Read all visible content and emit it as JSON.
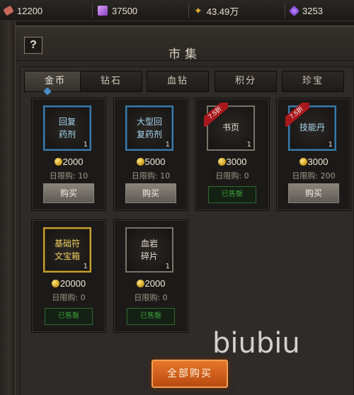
{
  "currencies": [
    {
      "icon": "ticket-icon",
      "value": "12200",
      "color": "#c8685a"
    },
    {
      "icon": "crystal-feather-icon",
      "value": "37500",
      "color": "#b070d8"
    },
    {
      "icon": "gold-star-icon",
      "value": "43.49万",
      "color": "#e8b030"
    },
    {
      "icon": "purple-gem-icon",
      "value": "3253",
      "color": "#8a50d8"
    }
  ],
  "panel": {
    "help_label": "?",
    "title": "市集"
  },
  "tabs": [
    {
      "label": "金币",
      "active": true
    },
    {
      "label": "钻石",
      "active": false
    },
    {
      "label": "血钻",
      "active": false
    },
    {
      "label": "积分",
      "active": false
    },
    {
      "label": "珍宝",
      "active": false
    }
  ],
  "items": [
    {
      "name_l1": "回复",
      "name_l2": "药剂",
      "rarity": "blue",
      "qty": "1",
      "price": "2000",
      "limit": "日限购: 10",
      "action": "购买",
      "sold_out": false,
      "discount": ""
    },
    {
      "name_l1": "大型回",
      "name_l2": "复药剂",
      "rarity": "blue",
      "qty": "1",
      "price": "5000",
      "limit": "日限购: 10",
      "action": "购买",
      "sold_out": false,
      "discount": ""
    },
    {
      "name_l1": "书页",
      "name_l2": "",
      "rarity": "white",
      "qty": "1",
      "price": "3000",
      "limit": "日限购: 0",
      "action": "已售罄",
      "sold_out": true,
      "discount": "7.5折"
    },
    {
      "name_l1": "技能丹",
      "name_l2": "",
      "rarity": "blue",
      "qty": "1",
      "price": "3000",
      "limit": "日限购: 200",
      "action": "购买",
      "sold_out": false,
      "discount": "7.5折"
    },
    {
      "name_l1": "基础符",
      "name_l2": "文宝箱",
      "rarity": "gold",
      "qty": "1",
      "price": "20000",
      "limit": "日限购: 0",
      "action": "已售罄",
      "sold_out": true,
      "discount": ""
    },
    {
      "name_l1": "血岩",
      "name_l2": "碎片",
      "rarity": "white",
      "qty": "1",
      "price": "2000",
      "limit": "日限购: 0",
      "action": "已售罄",
      "sold_out": true,
      "discount": ""
    }
  ],
  "watermark": "biubiu",
  "buy_all_label": "全部购买"
}
